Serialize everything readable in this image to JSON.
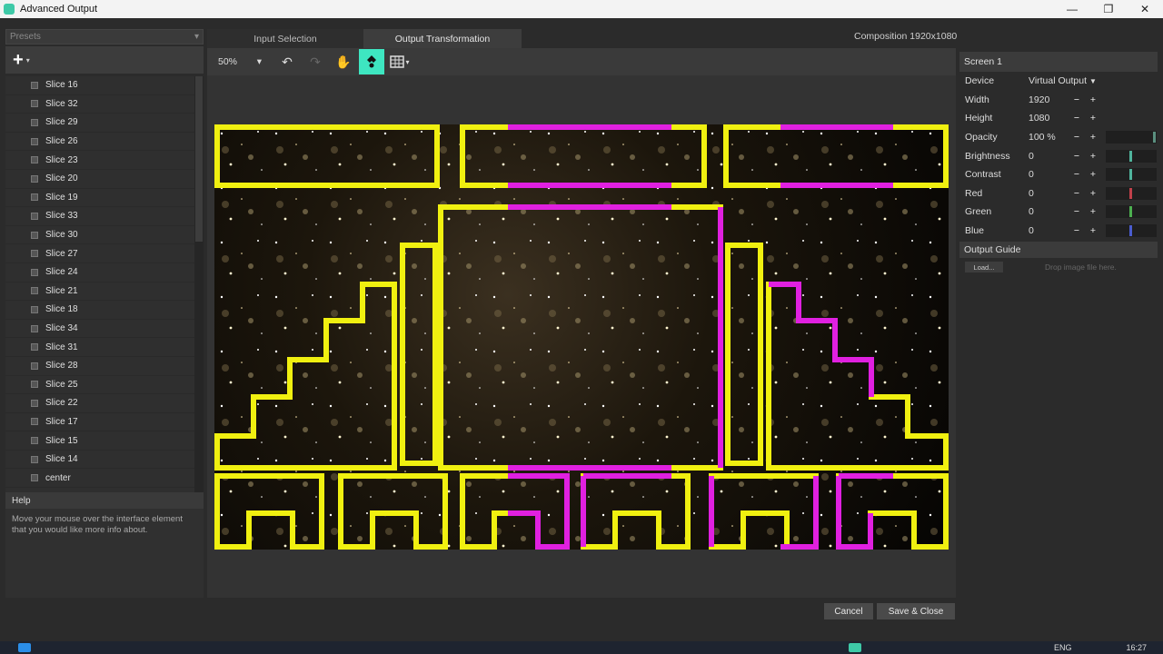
{
  "window": {
    "title": "Advanced Output",
    "controls": [
      "—",
      "❐",
      "✕"
    ]
  },
  "presets": {
    "value": "Presets"
  },
  "slices": [
    "Slice 16",
    "Slice 32",
    "Slice 29",
    "Slice 26",
    "Slice 23",
    "Slice 20",
    "Slice 19",
    "Slice 33",
    "Slice 30",
    "Slice 27",
    "Slice 24",
    "Slice 21",
    "Slice 18",
    "Slice 34",
    "Slice 31",
    "Slice 28",
    "Slice 25",
    "Slice 22",
    "Slice 17",
    "Slice 15",
    "Slice 14",
    "center"
  ],
  "help": {
    "title": "Help",
    "text": "Move your mouse over the interface element that you would like more info about."
  },
  "tabs": [
    {
      "label": "Input Selection",
      "active": false
    },
    {
      "label": "Output Transformation",
      "active": true
    }
  ],
  "composition": "Composition 1920x1080",
  "toolbar": {
    "zoom": "50%"
  },
  "screen": {
    "title": "Screen 1",
    "device_label": "Device",
    "device_value": "Virtual Output",
    "rows": [
      {
        "label": "Width",
        "value": "1920"
      },
      {
        "label": "Height",
        "value": "1080"
      },
      {
        "label": "Opacity",
        "value": "100 %",
        "bar": "#5a8f7f"
      },
      {
        "label": "Brightness",
        "value": "0",
        "bar": "#4fb39c"
      },
      {
        "label": "Contrast",
        "value": "0",
        "bar": "#4fb39c"
      },
      {
        "label": "Red",
        "value": "0",
        "bar": "#c0404a"
      },
      {
        "label": "Green",
        "value": "0",
        "bar": "#4caf50"
      },
      {
        "label": "Blue",
        "value": "0",
        "bar": "#4a5ccf"
      }
    ]
  },
  "output_guide": {
    "title": "Output Guide",
    "load": "Load...",
    "hint": "Drop image file here."
  },
  "buttons": {
    "cancel": "Cancel",
    "save_close": "Save & Close"
  },
  "taskbar": {
    "lang": "ENG",
    "time": "16:27"
  },
  "colors": {
    "accent": "#3ee6c1",
    "slice_yellow": "#f0f010",
    "slice_magenta": "#e020e0"
  }
}
